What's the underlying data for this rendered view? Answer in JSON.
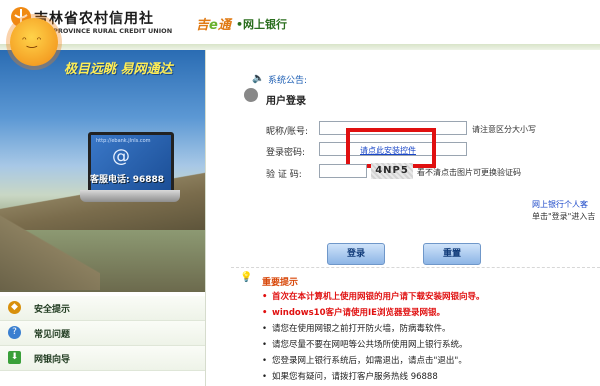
{
  "header": {
    "bank_name_cn": "吉林省农村信用社",
    "bank_name_en": "JILIN PROVINCE RURAL CREDIT UNION",
    "brand_logo_a": "吉",
    "brand_logo_b": "e",
    "brand_logo_c": "通",
    "brand_suffix": "•网上银行"
  },
  "banner": {
    "slogan": "极目远眺  易网通达",
    "screen_url": "http://ebank.jlnls.com",
    "hotline": "客服电话: 96888"
  },
  "menu": {
    "items": [
      {
        "label": "安全提示",
        "icon": "shield-icon"
      },
      {
        "label": "常见问题",
        "icon": "question-icon"
      },
      {
        "label": "网银向导",
        "icon": "download-icon"
      }
    ]
  },
  "notice": {
    "label": "系统公告:"
  },
  "login": {
    "title": "用户登录",
    "username_label": "昵称/账号:",
    "username_hint": "请注意区分大小写",
    "password_label": "登录密码:",
    "install_link": "请点此安装控件",
    "captcha_label": "验 证 码:",
    "captcha_text": "4NP5",
    "captcha_hint": "看不清点击图片可更换验证码",
    "side_link": "网上银行个人客",
    "side_note": "单击\"登录\"进入吉",
    "login_button": "登录",
    "reset_button": "重置"
  },
  "tips": {
    "title": "重要提示",
    "items": [
      {
        "text": "首次在本计算机上使用网银的用户请下载安装网银向导。",
        "color": "#e01010",
        "bold": true
      },
      {
        "text": "windows10客户请使用IE浏览器登录网银。",
        "color": "#e01010",
        "bold": true
      },
      {
        "text": "请您在使用网银之前打开防火墙，防病毒软件。",
        "color": "#222222",
        "bold": false
      },
      {
        "text": "请您尽量不要在网吧等公共场所使用网上银行系统。",
        "color": "#222222",
        "bold": false
      },
      {
        "text": "您登录网上银行系统后，如需退出，请点击\"退出\"。",
        "color": "#222222",
        "bold": false
      },
      {
        "text": "如果您有疑问，请拨打客户服务热线 96888",
        "color": "#222222",
        "bold": false
      }
    ]
  },
  "colors": {
    "accent": "#1e5fb4",
    "warning": "#e01010",
    "tips_title": "#d8480a"
  }
}
